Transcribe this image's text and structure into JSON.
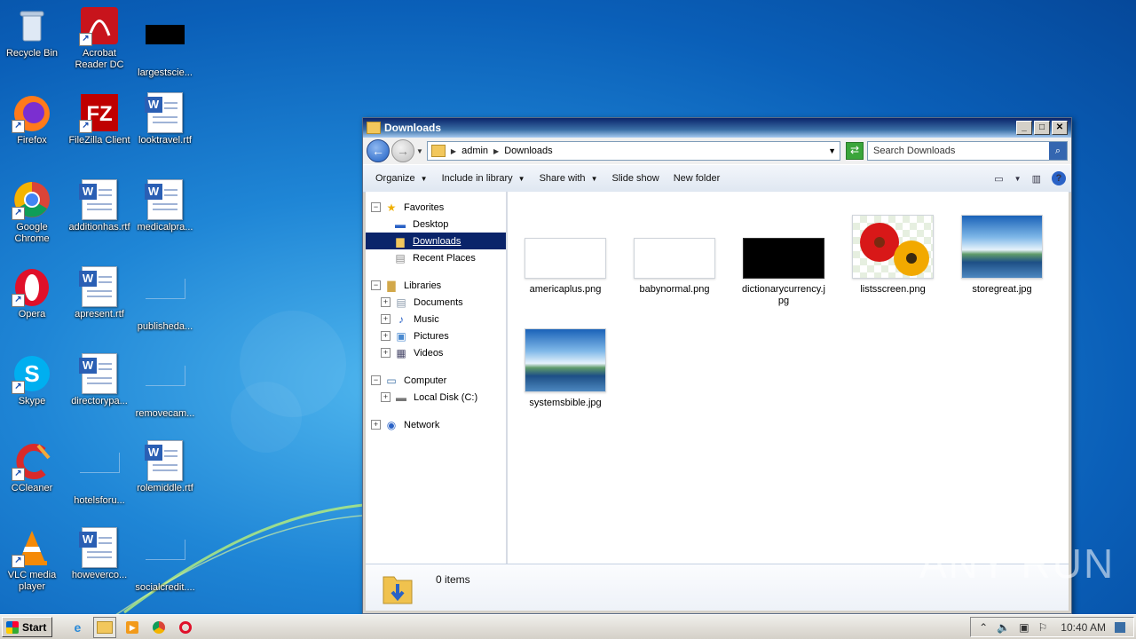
{
  "desktop": {
    "icons": [
      {
        "label": "Recycle Bin"
      },
      {
        "label": "Acrobat Reader DC"
      },
      {
        "label": "largestscie..."
      },
      {
        "label": "Firefox"
      },
      {
        "label": "FileZilla Client"
      },
      {
        "label": "looktravel.rtf"
      },
      {
        "label": "Google Chrome"
      },
      {
        "label": "additionhas.rtf"
      },
      {
        "label": "medicalpra..."
      },
      {
        "label": "Opera"
      },
      {
        "label": "apresent.rtf"
      },
      {
        "label": "publisheda..."
      },
      {
        "label": "Skype"
      },
      {
        "label": "directorypa..."
      },
      {
        "label": "removecam..."
      },
      {
        "label": "CCleaner"
      },
      {
        "label": "hotelsforu..."
      },
      {
        "label": "rolemiddle.rtf"
      },
      {
        "label": "VLC media player"
      },
      {
        "label": "howeverco..."
      },
      {
        "label": "socialcredit...."
      }
    ]
  },
  "window": {
    "title": "Downloads",
    "buttons": {
      "minimize": "_",
      "maximize": "□",
      "close": "✕"
    },
    "address": {
      "crumbs": [
        "admin",
        "Downloads"
      ]
    },
    "search_placeholder": "Search Downloads",
    "toolbar": {
      "organize": "Organize",
      "include_in_library": "Include in library",
      "share_with": "Share with",
      "slide_show": "Slide show",
      "new_folder": "New folder"
    },
    "nav": {
      "favorites": "Favorites",
      "desktop": "Desktop",
      "downloads": "Downloads",
      "recent_places": "Recent Places",
      "libraries": "Libraries",
      "documents": "Documents",
      "music": "Music",
      "pictures": "Pictures",
      "videos": "Videos",
      "computer": "Computer",
      "local_disk": "Local Disk (C:)",
      "network": "Network"
    },
    "files": [
      {
        "name": "americaplus.png"
      },
      {
        "name": "babynormal.png"
      },
      {
        "name": "dictionarycurrency.jpg"
      },
      {
        "name": "listsscreen.png"
      },
      {
        "name": "storegreat.jpg"
      },
      {
        "name": "systemsbible.jpg"
      }
    ],
    "details": {
      "count": "0 items"
    }
  },
  "taskbar": {
    "start": "Start",
    "clock": "10:40 AM"
  },
  "watermark": "ANY RUN"
}
